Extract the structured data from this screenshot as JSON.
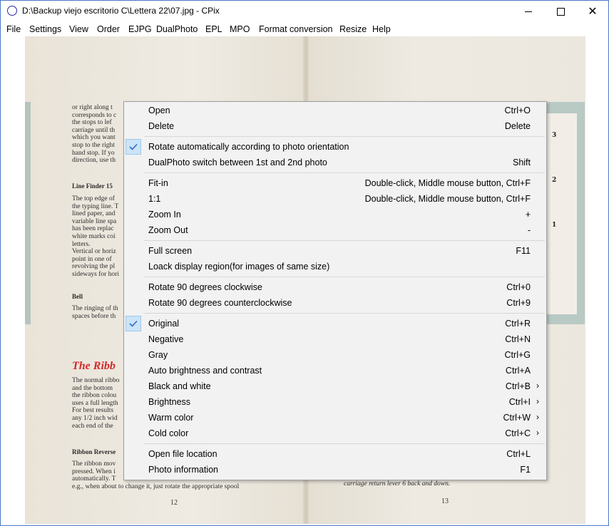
{
  "window": {
    "title": "D:\\Backup viejo escritorio C\\Lettera 22\\07.jpg - CPix",
    "app_icon": "circle-icon",
    "controls": {
      "minimize": "minimize-icon",
      "maximize": "maximize-icon",
      "close": "✕"
    }
  },
  "menubar": [
    "File",
    "Settings",
    "View",
    "Order",
    "EJPG",
    "DualPhoto",
    "EPL",
    "MPO",
    "Format conversion",
    "Resize",
    "Help"
  ],
  "context_menu": {
    "open": {
      "label": "Open",
      "shortcut": "Ctrl+O"
    },
    "delete": {
      "label": "Delete",
      "shortcut": "Delete"
    },
    "rotate_auto": {
      "label": "Rotate automatically according to photo orientation",
      "checked": true
    },
    "dualphoto_switch": {
      "label": "DualPhoto switch between 1st and 2nd photo",
      "shortcut": "Shift"
    },
    "fit_in": {
      "label": "Fit-in",
      "shortcut": "Double-click, Middle mouse button, Ctrl+F"
    },
    "one_to_one": {
      "label": "1:1",
      "shortcut": "Double-click, Middle mouse button, Ctrl+F"
    },
    "zoom_in": {
      "label": "Zoom In",
      "shortcut": "+"
    },
    "zoom_out": {
      "label": "Zoom Out",
      "shortcut": "-"
    },
    "full_screen": {
      "label": "Full screen",
      "shortcut": "F11"
    },
    "lock_region": {
      "label": "Loack display region(for images of same size)"
    },
    "rot_cw": {
      "label": "Rotate 90 degrees clockwise",
      "shortcut": "Ctrl+0"
    },
    "rot_ccw": {
      "label": "Rotate 90 degrees counterclockwise",
      "shortcut": "Ctrl+9"
    },
    "original": {
      "label": "Original",
      "shortcut": "Ctrl+R",
      "checked": true
    },
    "negative": {
      "label": "Negative",
      "shortcut": "Ctrl+N"
    },
    "gray": {
      "label": "Gray",
      "shortcut": "Ctrl+G"
    },
    "auto_brightness": {
      "label": "Auto brightness and contrast",
      "shortcut": "Ctrl+A"
    },
    "black_white": {
      "label": "Black and white",
      "shortcut": "Ctrl+B",
      "submenu": true
    },
    "brightness": {
      "label": "Brightness",
      "shortcut": "Ctrl+I",
      "submenu": true
    },
    "warm": {
      "label": "Warm color",
      "shortcut": "Ctrl+W",
      "submenu": true
    },
    "cold": {
      "label": "Cold color",
      "shortcut": "Ctrl+C",
      "submenu": true
    },
    "open_location": {
      "label": "Open file location",
      "shortcut": "Ctrl+L"
    },
    "photo_info": {
      "label": "Photo information",
      "shortcut": "F1"
    },
    "check_icon": "checkmark-icon",
    "submenu_arrow": "›"
  },
  "photo": {
    "left": {
      "para1": "or right along t\ncorresponds to c\nthe stops to lef\ncarriage until th\nwhich you want\nstop to the right\nhand stop. If yo\ndirection, use th",
      "line_finder": "Line Finder 15",
      "para2": "The top edge of\nthe typing line. T\nlined paper, and\nvariable line spa\nhas been replac\nwhite marks coi\nletters.\nVertical or horiz\npoint in one of\nrevolving the pl\nsideways for hori",
      "bell": "Bell",
      "para3": "The ringing of th\nspaces before th",
      "ribbon_heading": "The Ribb",
      "para4": "The normal ribbo\nand the bottom\nthe ribbon colou\nuses a full length\nFor best results\nany 1/2 inch wid\neach end of the",
      "ribbon_reverse": "Ribbon Reverse",
      "para5": "The ribbon mov\npressed. When i\nautomatically. T\ne.g., when about to change it, just rotate the appropriate spool",
      "page_number": "12"
    },
    "right": {
      "num3": "3",
      "num2": "2",
      "num1": "1",
      "bottom_line": "carriage return lever 6 back and down.",
      "page_number": "13"
    }
  },
  "colors": {
    "accent": "#cce4f7",
    "check": "#2b6cc4",
    "red_heading": "#d22a2a",
    "panel_teal": "#b9c9c4"
  }
}
